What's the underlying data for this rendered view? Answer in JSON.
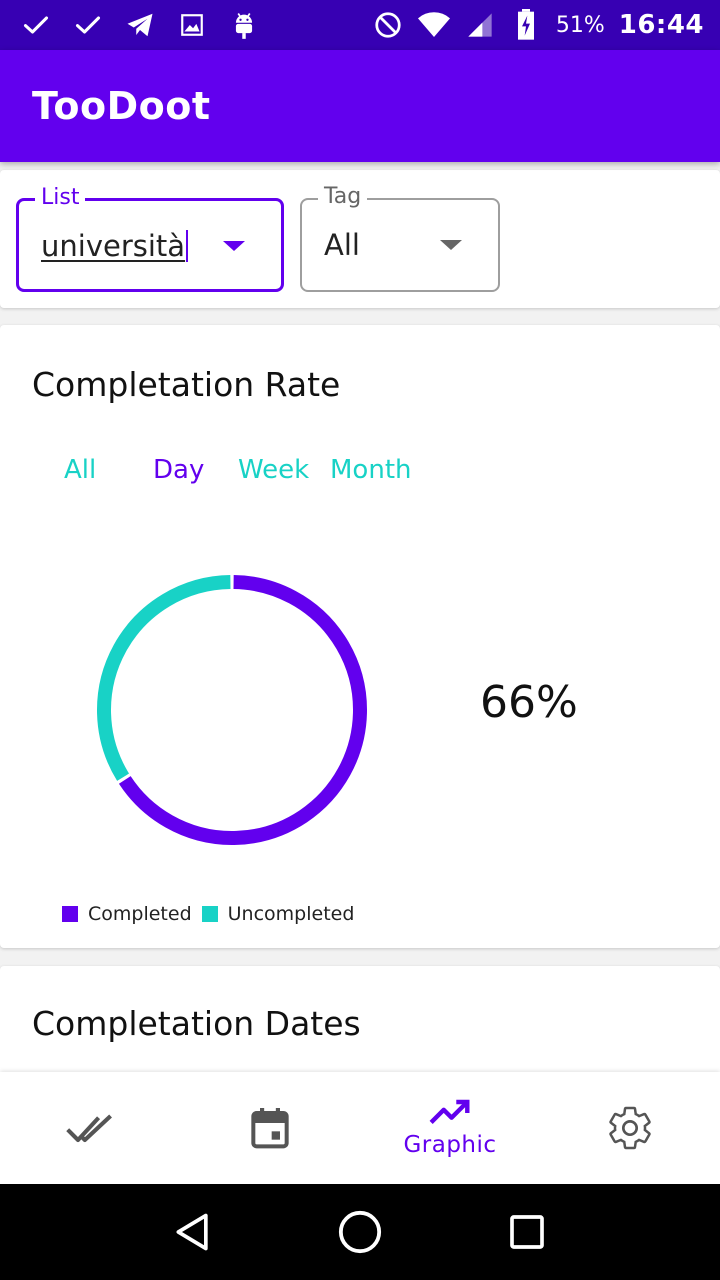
{
  "status_bar": {
    "left_icons": [
      "check-icon",
      "check-icon",
      "telegram-icon",
      "image-icon",
      "android-icon"
    ],
    "right_icons": [
      "do-not-disturb-icon",
      "wifi-icon",
      "signal-icon",
      "battery-charging-icon"
    ],
    "battery": "51%",
    "time": "16:44"
  },
  "app_bar": {
    "title": "TooDoot"
  },
  "filters": {
    "list": {
      "label": "List",
      "value": "università"
    },
    "tag": {
      "label": "Tag",
      "value": "All"
    }
  },
  "completion_rate": {
    "title": "Completation Rate",
    "periods": [
      "All",
      "Day",
      "Week",
      "Month"
    ],
    "active_period": "Day",
    "percent_label": "66%",
    "legend": {
      "completed": "Completed",
      "uncompleted": "Uncompleted"
    }
  },
  "chart_data": {
    "type": "pie",
    "labels": [
      "Completed",
      "Uncompleted"
    ],
    "values": [
      66,
      34
    ],
    "colors": [
      "#6200ee",
      "#18d2c6"
    ],
    "legend_position": "bottom-left"
  },
  "completion_dates": {
    "title": "Completation Dates"
  },
  "bottom_nav": {
    "items": [
      {
        "icon": "done-all-icon",
        "label": ""
      },
      {
        "icon": "calendar-icon",
        "label": ""
      },
      {
        "icon": "trending-up-icon",
        "label": "Graphic"
      },
      {
        "icon": "settings-icon",
        "label": ""
      }
    ],
    "active_index": 2
  },
  "system_nav": [
    "back-icon",
    "home-icon",
    "recents-icon"
  ],
  "colors": {
    "primary": "#6200ee",
    "primary_dark": "#3700b3",
    "accent": "#18d2c6"
  }
}
